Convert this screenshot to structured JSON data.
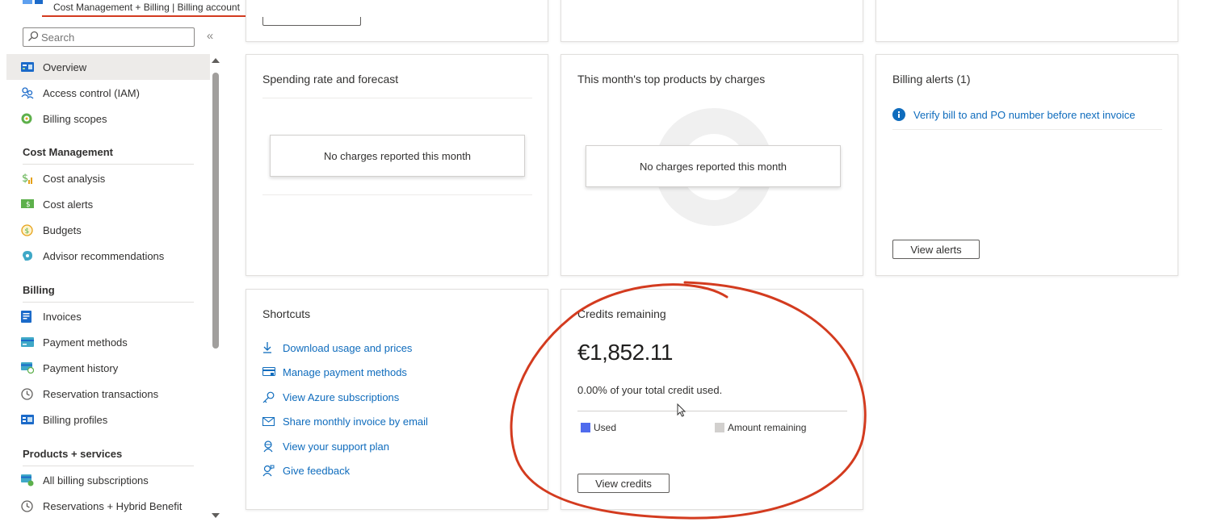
{
  "header": {
    "breadcrumb": "Cost Management + Billing | Billing account"
  },
  "colors": {
    "accent": "#0f6cbd",
    "annotation_red": "#d33b1f",
    "used": "#4f6bed",
    "remaining": "#d2d0ce"
  },
  "sidebar": {
    "search_placeholder": "Search",
    "collapse_glyph": "«",
    "items_top": [
      {
        "label": "Overview",
        "icon": "overview-icon"
      },
      {
        "label": "Access control (IAM)",
        "icon": "people-icon"
      },
      {
        "label": "Billing scopes",
        "icon": "scope-icon"
      }
    ],
    "section_cost": "Cost Management",
    "items_cost": [
      {
        "label": "Cost analysis",
        "icon": "cost-analysis-icon"
      },
      {
        "label": "Cost alerts",
        "icon": "cost-alert-icon"
      },
      {
        "label": "Budgets",
        "icon": "budget-icon"
      },
      {
        "label": "Advisor recommendations",
        "icon": "advisor-icon"
      }
    ],
    "section_billing": "Billing",
    "items_billing": [
      {
        "label": "Invoices",
        "icon": "invoice-icon"
      },
      {
        "label": "Payment methods",
        "icon": "payment-card-icon"
      },
      {
        "label": "Payment history",
        "icon": "payment-history-icon"
      },
      {
        "label": "Reservation transactions",
        "icon": "clock-icon"
      },
      {
        "label": "Billing profiles",
        "icon": "billing-profile-icon"
      }
    ],
    "section_products": "Products + services",
    "items_products": [
      {
        "label": "All billing subscriptions",
        "icon": "subscriptions-icon"
      },
      {
        "label": "Reservations + Hybrid Benefit",
        "icon": "clock-icon"
      }
    ]
  },
  "spending": {
    "title": "Spending rate and forecast",
    "empty": "No charges reported this month"
  },
  "top_products": {
    "title": "This month's top products by charges",
    "empty": "No charges reported this month"
  },
  "alerts": {
    "title": "Billing alerts (1)",
    "item": "Verify bill to and PO number before next invoice",
    "button": "View alerts"
  },
  "shortcuts": {
    "title": "Shortcuts",
    "items": [
      {
        "label": "Download usage and prices",
        "icon": "download-icon"
      },
      {
        "label": "Manage payment methods",
        "icon": "payment-card-icon"
      },
      {
        "label": "View Azure subscriptions",
        "icon": "key-icon"
      },
      {
        "label": "Share monthly invoice by email",
        "icon": "mail-icon"
      },
      {
        "label": "View your support plan",
        "icon": "support-icon"
      },
      {
        "label": "Give feedback",
        "icon": "feedback-icon"
      }
    ]
  },
  "credits": {
    "title": "Credits remaining",
    "amount": "€1,852.11",
    "used_text": "0.00% of your total credit used.",
    "used_fraction": 0.0,
    "legend_used": "Used",
    "legend_remaining": "Amount remaining",
    "button": "View credits"
  }
}
